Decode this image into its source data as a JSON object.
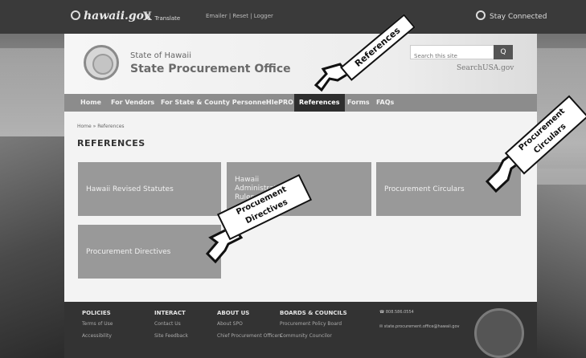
{
  "topbar": {
    "logo": "hawaii.gov",
    "translate_label": "Translate",
    "links": "Emailer | Reset | Logger",
    "stay_connected": "Stay Connected"
  },
  "header": {
    "state": "State of Hawaii",
    "office": "State Procurement Office",
    "search_placeholder": "Search this site",
    "search_btn": "Q",
    "searchusa": "SearchUSA.gov"
  },
  "nav": {
    "items": [
      "Home",
      "For Vendors",
      "For State & County Personnel",
      "HIePRO",
      "References",
      "Forms",
      "FAQs"
    ]
  },
  "breadcrumb": "Home » References",
  "page_title": "REFERENCES",
  "tiles": [
    "Hawaii Revised Statutes",
    "Hawaii Administrative Rules",
    "Procurement Circulars",
    "Procurement Directives"
  ],
  "callouts": {
    "references": "References",
    "circulars_line1": "Procurement",
    "circulars_line2": "Circulars",
    "directives_line1": "Procuement",
    "directives_line2": "Directives"
  },
  "footer": {
    "policies": {
      "heading": "POLICIES",
      "links": [
        "Terms of Use",
        "Accessibility"
      ]
    },
    "interact": {
      "heading": "INTERACT",
      "links": [
        "Contact Us",
        "Site Feedback"
      ]
    },
    "about": {
      "heading": "ABOUT US",
      "links": [
        "About SPO",
        "Chief Procurement Officers"
      ]
    },
    "boards": {
      "heading": "BOARDS & COUNCILS",
      "links": [
        "Procurement Policy Board",
        "Community Councilor"
      ]
    },
    "phone": "808.586.0554",
    "email": "state.procurement.office@hawaii.gov"
  },
  "colors": {
    "nav_bg": "#8c8c8c",
    "nav_active": "#2e2e2e",
    "tile_bg": "#999999",
    "footer_bg": "#333333"
  }
}
